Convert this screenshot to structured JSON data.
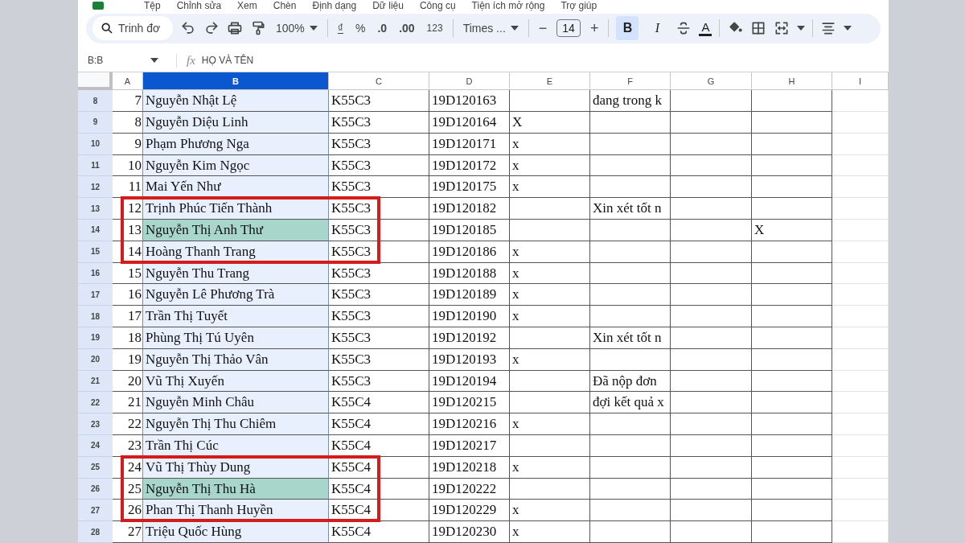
{
  "menu": [
    "Tệp",
    "Chỉnh sửa",
    "Xem",
    "Chèn",
    "Định dạng",
    "Dữ liệu",
    "Công cụ",
    "Tiện ích mở rộng",
    "Trợ giúp"
  ],
  "toolbar": {
    "search_placeholder": "Trinh đơ",
    "zoom": "100%",
    "currency": "₫",
    "percent": "%",
    "decrease_decimal": ".0",
    "increase_decimal": ".00",
    "number_format": "123",
    "font": "Times ...",
    "font_minus": "−",
    "font_size": "14",
    "font_plus": "+",
    "styles": [
      {
        "label": "B",
        "selected": true
      },
      {
        "label": "I",
        "selected": false
      }
    ],
    "text_color": "A"
  },
  "formula_bar": {
    "name_box": "B:B",
    "fx": "fx",
    "formula": "HỌ VÀ TÊN"
  },
  "columns": [
    {
      "label": "A",
      "selected": false
    },
    {
      "label": "B",
      "selected": true
    },
    {
      "label": "C",
      "selected": false
    },
    {
      "label": "D",
      "selected": false
    },
    {
      "label": "E",
      "selected": false
    },
    {
      "label": "F",
      "selected": false
    },
    {
      "label": "G",
      "selected": false
    },
    {
      "label": "H",
      "selected": false
    },
    {
      "label": "I",
      "selected": false
    }
  ],
  "rows": [
    {
      "row": "8",
      "a": "7",
      "b": "Nguyễn Nhật Lệ",
      "c": "K55C3",
      "d": "19D120163",
      "f": "đang trong k",
      "highlighted": false,
      "boxed": false
    },
    {
      "row": "9",
      "a": "8",
      "b": "Nguyễn Diệu Linh",
      "c": "K55C3",
      "d": "19D120164",
      "e": "X",
      "highlighted": false,
      "boxed": false
    },
    {
      "row": "10",
      "a": "9",
      "b": "Phạm Phương Nga",
      "c": "K55C3",
      "d": "19D120171",
      "e": "x",
      "highlighted": false,
      "boxed": false
    },
    {
      "row": "11",
      "a": "10",
      "b": "Nguyễn Kim Ngọc",
      "c": "K55C3",
      "d": "19D120172",
      "e": "x",
      "highlighted": false,
      "boxed": false
    },
    {
      "row": "12",
      "a": "11",
      "b": "Mai Yến Như",
      "c": "K55C3",
      "d": "19D120175",
      "e": "x",
      "highlighted": false,
      "boxed": false
    },
    {
      "row": "13",
      "a": "12",
      "b": "Trịnh Phúc Tiến Thành",
      "c": "K55C3",
      "d": "19D120182",
      "f": "Xin xét tốt n",
      "highlighted": false,
      "boxed": true
    },
    {
      "row": "14",
      "a": "13",
      "b": "Nguyễn Thị Anh Thư",
      "c": "K55C3",
      "d": "19D120185",
      "h": "X",
      "highlighted": true,
      "boxed": true
    },
    {
      "row": "15",
      "a": "14",
      "b": "Hoàng Thanh Trang",
      "c": "K55C3",
      "d": "19D120186",
      "e": "x",
      "highlighted": false,
      "boxed": true
    },
    {
      "row": "16",
      "a": "15",
      "b": "Nguyễn Thu Trang",
      "c": "K55C3",
      "d": "19D120188",
      "e": "x",
      "highlighted": false,
      "boxed": false
    },
    {
      "row": "17",
      "a": "16",
      "b": "Nguyễn Lê Phương Trà",
      "c": "K55C3",
      "d": "19D120189",
      "e": "x",
      "highlighted": false,
      "boxed": false
    },
    {
      "row": "18",
      "a": "17",
      "b": "Trần Thị Tuyết",
      "c": "K55C3",
      "d": "19D120190",
      "e": "x",
      "highlighted": false,
      "boxed": false
    },
    {
      "row": "19",
      "a": "18",
      "b": "Phùng Thị Tú Uyên",
      "c": "K55C3",
      "d": "19D120192",
      "f": "Xin xét tốt n",
      "highlighted": false,
      "boxed": false
    },
    {
      "row": "20",
      "a": "19",
      "b": "Nguyễn Thị Thảo Vân",
      "c": "K55C3",
      "d": "19D120193",
      "e": "x",
      "highlighted": false,
      "boxed": false
    },
    {
      "row": "21",
      "a": "20",
      "b": "Vũ Thị Xuyến",
      "c": "K55C3",
      "d": "19D120194",
      "f": "Đã nộp đơn",
      "highlighted": false,
      "boxed": false
    },
    {
      "row": "22",
      "a": "21",
      "b": "Nguyễn Minh Châu",
      "c": "K55C4",
      "d": "19D120215",
      "f": "đợi kết quả x",
      "highlighted": false,
      "boxed": false
    },
    {
      "row": "23",
      "a": "22",
      "b": "Nguyễn Thị Thu Chiêm",
      "c": "K55C4",
      "d": "19D120216",
      "e": "x",
      "highlighted": false,
      "boxed": false
    },
    {
      "row": "24",
      "a": "23",
      "b": "Trần Thị Cúc",
      "c": "K55C4",
      "d": "19D120217",
      "highlighted": false,
      "boxed": false
    },
    {
      "row": "25",
      "a": "24",
      "b": "Vũ Thị Thùy Dung",
      "c": "K55C4",
      "d": "19D120218",
      "e": "x",
      "highlighted": false,
      "boxed": true
    },
    {
      "row": "26",
      "a": "25",
      "b": "Nguyễn Thị Thu Hà",
      "c": "K55C4",
      "d": "19D120222",
      "highlighted": true,
      "boxed": true
    },
    {
      "row": "27",
      "a": "26",
      "b": "Phan Thị Thanh Huyền",
      "c": "K55C4",
      "d": "19D120229",
      "e": "x",
      "highlighted": false,
      "boxed": true
    },
    {
      "row": "28",
      "a": "27",
      "b": "Triệu Quốc Hùng",
      "c": "K55C4",
      "d": "19D120230",
      "e": "x",
      "highlighted": false,
      "boxed": false
    }
  ]
}
